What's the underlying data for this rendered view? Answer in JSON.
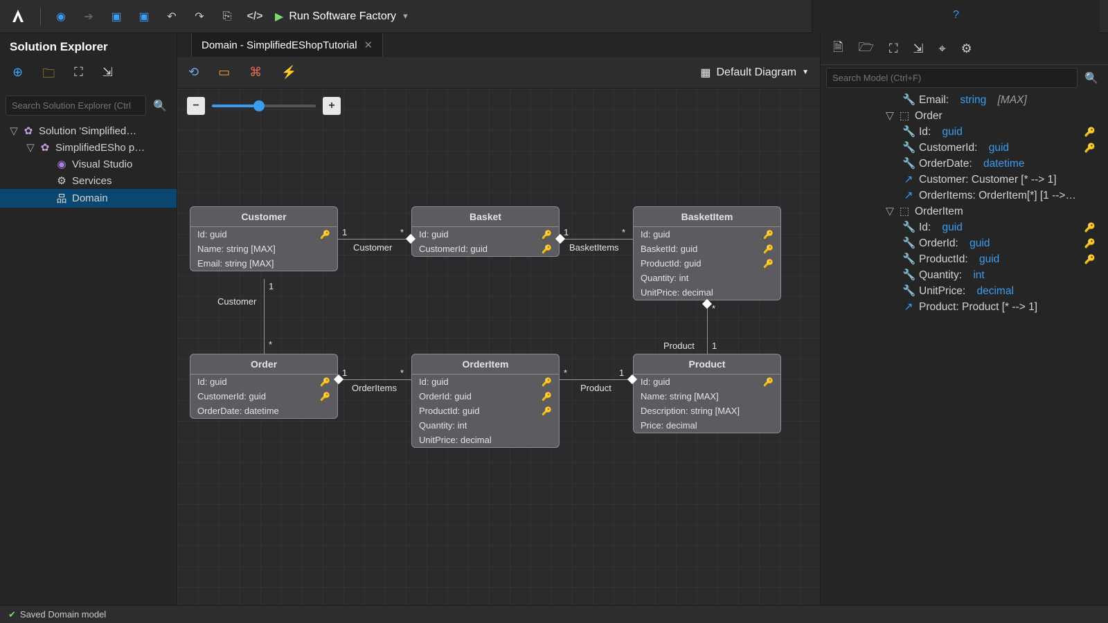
{
  "topbar": {
    "run_label": "Run Software Factory"
  },
  "left_panel": {
    "title": "Solution Explorer",
    "search_placeholder": "Search Solution Explorer (Ctrl",
    "tree": {
      "root": "Solution 'Simplified…",
      "project": "SimplifiedESho p…",
      "vs": "Visual Studio",
      "services": "Services",
      "domain": "Domain"
    }
  },
  "tab": {
    "title": "Domain - SimplifiedEShopTutorial"
  },
  "diagram_selector": "Default Diagram",
  "entities": {
    "customer": {
      "title": "Customer",
      "rows": [
        "Id: guid",
        "Name: string [MAX]",
        "Email: string [MAX]"
      ]
    },
    "basket": {
      "title": "Basket",
      "rows": [
        "Id: guid",
        "CustomerId: guid"
      ]
    },
    "basketitem": {
      "title": "BasketItem",
      "rows": [
        "Id: guid",
        "BasketId: guid",
        "ProductId: guid",
        "Quantity: int",
        "UnitPrice: decimal"
      ]
    },
    "order": {
      "title": "Order",
      "rows": [
        "Id: guid",
        "CustomerId: guid",
        "OrderDate: datetime"
      ]
    },
    "orderitem": {
      "title": "OrderItem",
      "rows": [
        "Id: guid",
        "OrderId: guid",
        "ProductId: guid",
        "Quantity: int",
        "UnitPrice: decimal"
      ]
    },
    "product": {
      "title": "Product",
      "rows": [
        "Id: guid",
        "Name: string [MAX]",
        "Description: string [MAX]",
        "Price: decimal"
      ]
    }
  },
  "relations": {
    "customer_basket_left": "1",
    "customer_basket_right": "*",
    "customer_basket_label": "Customer",
    "basket_items_left": "1",
    "basket_items_right": "*",
    "basket_items_label": "BasketItems",
    "customer_order_top": "1",
    "customer_order_bot": "*",
    "customer_order_label": "Customer",
    "order_items_left": "1",
    "order_items_right": "*",
    "order_items_label": "OrderItems",
    "item_product_left": "*",
    "item_product_right": "1",
    "item_product_label": "Product",
    "bitem_product_top": "*",
    "bitem_product_bot": "1",
    "bitem_product_label": "Product"
  },
  "right_panel": {
    "search_placeholder": "Search Model (Ctrl+F)",
    "rows": [
      {
        "lv": "B",
        "ic": "key",
        "label": "Email:",
        "typ": "string",
        "ann": "[MAX]"
      },
      {
        "lv": "A",
        "ic": "cls",
        "exp": "▽",
        "label": "Order"
      },
      {
        "lv": "B",
        "ic": "key",
        "label": "Id:",
        "typ": "guid",
        "trail": "🔑"
      },
      {
        "lv": "B",
        "ic": "key",
        "label": "CustomerId:",
        "typ": "guid",
        "trail": "🔑",
        "tg": true
      },
      {
        "lv": "B",
        "ic": "key",
        "label": "OrderDate:",
        "typ": "datetime"
      },
      {
        "lv": "B",
        "ic": "nav",
        "label": "Customer: Customer [* --> 1]"
      },
      {
        "lv": "B",
        "ic": "nav",
        "label": "OrderItems: OrderItem[*] [1 -->…"
      },
      {
        "lv": "A",
        "ic": "cls",
        "exp": "▽",
        "label": "OrderItem"
      },
      {
        "lv": "B",
        "ic": "key",
        "label": "Id:",
        "typ": "guid",
        "trail": "🔑"
      },
      {
        "lv": "B",
        "ic": "key",
        "label": "OrderId:",
        "typ": "guid",
        "trail": "🔑",
        "tg": true
      },
      {
        "lv": "B",
        "ic": "key",
        "label": "ProductId:",
        "typ": "guid",
        "trail": "🔑",
        "tg": true
      },
      {
        "lv": "B",
        "ic": "key",
        "label": "Quantity:",
        "typ": "int"
      },
      {
        "lv": "B",
        "ic": "key",
        "label": "UnitPrice:",
        "typ": "decimal"
      },
      {
        "lv": "B",
        "ic": "nav",
        "label": "Product: Product [* --> 1]"
      }
    ]
  },
  "status": {
    "text": "Saved Domain model"
  }
}
